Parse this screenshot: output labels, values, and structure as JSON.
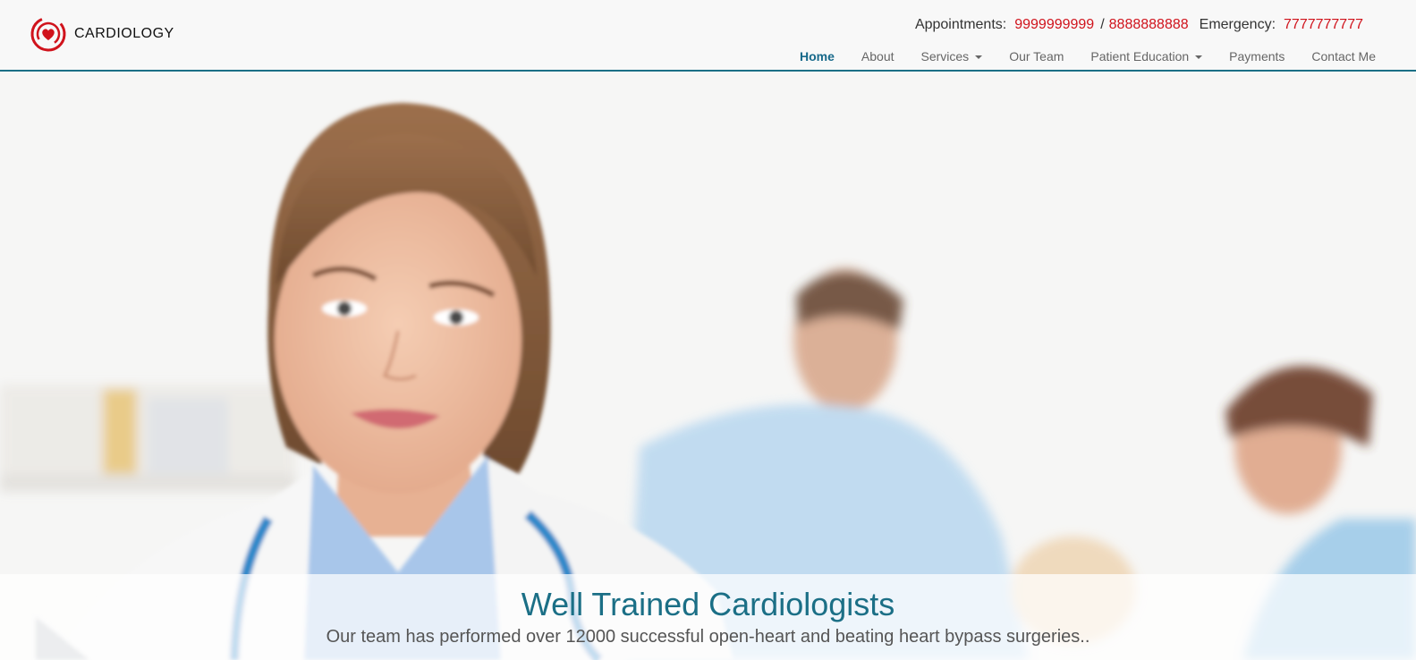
{
  "brand": {
    "name": "CARDIOLOGY",
    "logo_icon": "heart-target-icon",
    "color": "#d0131c"
  },
  "contact": {
    "appointments_label": "Appointments:",
    "appointment_phone_1": "9999999999",
    "separator": "/",
    "appointment_phone_2": "8888888888",
    "emergency_label": "Emergency:",
    "emergency_phone": "7777777777"
  },
  "nav": {
    "home": "Home",
    "about": "About",
    "services": "Services",
    "our_team": "Our Team",
    "patient_education": "Patient Education",
    "payments": "Payments",
    "contact_me": "Contact Me"
  },
  "hero": {
    "title": "Well Trained Cardiologists",
    "subtitle": "Our team has performed over 12000 successful open-heart and beating heart bypass surgeries.."
  },
  "colors": {
    "accent": "#1b6f86",
    "phone": "#d0131c",
    "nav_active": "#17698a"
  }
}
